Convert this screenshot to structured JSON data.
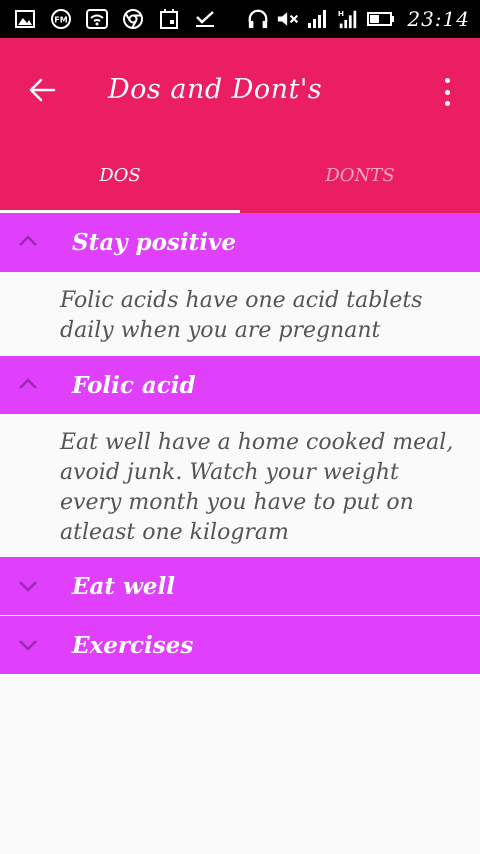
{
  "status_bar": {
    "time": "23:14",
    "icons": [
      "image-icon",
      "fm-radio-icon",
      "wifi-icon",
      "chrome-icon",
      "calendar-icon",
      "download-done-icon",
      "headset-icon",
      "mute-icon",
      "signal-icon",
      "signal-h-icon",
      "battery-icon"
    ]
  },
  "app_bar": {
    "title": "Dos and Dont's"
  },
  "tabs": [
    {
      "label": "DOS",
      "selected": true
    },
    {
      "label": "DONTS",
      "selected": false
    }
  ],
  "sections": [
    {
      "title": "Stay positive",
      "expanded": true,
      "body": "Folic acids have one acid tablets daily when you are pregnant"
    },
    {
      "title": "Folic acid",
      "expanded": true,
      "body": "Eat well have a home cooked meal, avoid junk. Watch your weight every month you have to put on atleast one kilogram"
    },
    {
      "title": "Eat well",
      "expanded": false
    },
    {
      "title": "Exercises",
      "expanded": false
    }
  ],
  "colors": {
    "app_bar": "#ec1e63",
    "section_header": "#e040fb",
    "background": "#fafafa"
  }
}
